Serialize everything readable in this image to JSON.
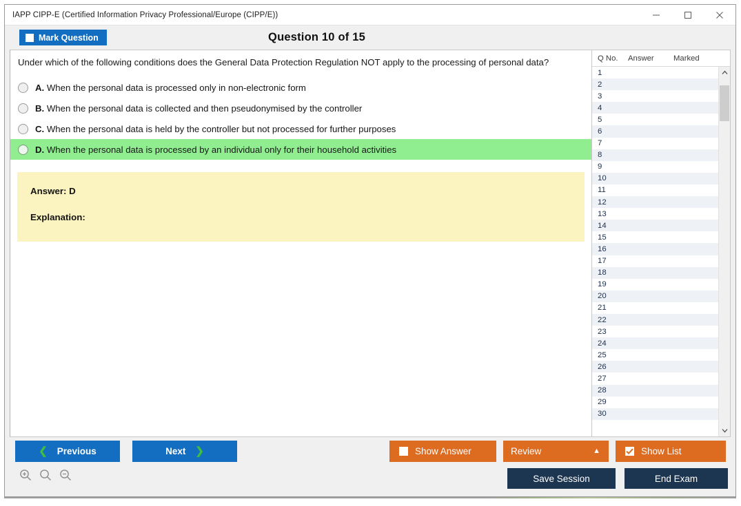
{
  "window": {
    "title": "IAPP CIPP-E (Certified Information Privacy Professional/Europe (CIPP/E))",
    "controls": {
      "minimize": "minimize-icon",
      "maximize": "maximize-icon",
      "close": "close-icon"
    }
  },
  "header": {
    "mark_button": "Mark Question",
    "question_counter": "Question 10 of 15"
  },
  "question": {
    "text": "Under which of the following conditions does the General Data Protection Regulation NOT apply to the processing of personal data?",
    "options": [
      {
        "letter": "A.",
        "text": "When the personal data is processed only in non-electronic form",
        "selected": false
      },
      {
        "letter": "B.",
        "text": "When the personal data is collected and then pseudonymised by the controller",
        "selected": false
      },
      {
        "letter": "C.",
        "text": "When the personal data is held by the controller but not processed for further purposes",
        "selected": false
      },
      {
        "letter": "D.",
        "text": "When the personal data is processed by an individual only for their household activities",
        "selected": true
      }
    ],
    "answer_label": "Answer: D",
    "explanation_label": "Explanation:"
  },
  "list_panel": {
    "columns": [
      "Q No.",
      "Answer",
      "Marked"
    ],
    "rows": [
      {
        "no": "1",
        "answer": "",
        "marked": ""
      },
      {
        "no": "2",
        "answer": "",
        "marked": ""
      },
      {
        "no": "3",
        "answer": "",
        "marked": ""
      },
      {
        "no": "4",
        "answer": "",
        "marked": ""
      },
      {
        "no": "5",
        "answer": "",
        "marked": ""
      },
      {
        "no": "6",
        "answer": "",
        "marked": ""
      },
      {
        "no": "7",
        "answer": "",
        "marked": ""
      },
      {
        "no": "8",
        "answer": "",
        "marked": ""
      },
      {
        "no": "9",
        "answer": "",
        "marked": ""
      },
      {
        "no": "10",
        "answer": "",
        "marked": ""
      },
      {
        "no": "11",
        "answer": "",
        "marked": ""
      },
      {
        "no": "12",
        "answer": "",
        "marked": ""
      },
      {
        "no": "13",
        "answer": "",
        "marked": ""
      },
      {
        "no": "14",
        "answer": "",
        "marked": ""
      },
      {
        "no": "15",
        "answer": "",
        "marked": ""
      },
      {
        "no": "16",
        "answer": "",
        "marked": ""
      },
      {
        "no": "17",
        "answer": "",
        "marked": ""
      },
      {
        "no": "18",
        "answer": "",
        "marked": ""
      },
      {
        "no": "19",
        "answer": "",
        "marked": ""
      },
      {
        "no": "20",
        "answer": "",
        "marked": ""
      },
      {
        "no": "21",
        "answer": "",
        "marked": ""
      },
      {
        "no": "22",
        "answer": "",
        "marked": ""
      },
      {
        "no": "23",
        "answer": "",
        "marked": ""
      },
      {
        "no": "24",
        "answer": "",
        "marked": ""
      },
      {
        "no": "25",
        "answer": "",
        "marked": ""
      },
      {
        "no": "26",
        "answer": "",
        "marked": ""
      },
      {
        "no": "27",
        "answer": "",
        "marked": ""
      },
      {
        "no": "28",
        "answer": "",
        "marked": ""
      },
      {
        "no": "29",
        "answer": "",
        "marked": ""
      },
      {
        "no": "30",
        "answer": "",
        "marked": ""
      }
    ]
  },
  "footer": {
    "previous": "Previous",
    "next": "Next",
    "show_answer": "Show Answer",
    "show_answer_checked": false,
    "review": "Review",
    "show_list": "Show List",
    "show_list_checked": true,
    "save_session": "Save Session",
    "end_exam": "End Exam",
    "zoom_in": "zoom-in-icon",
    "zoom_reset": "zoom-reset-icon",
    "zoom_out": "zoom-out-icon"
  },
  "colors": {
    "accent_blue": "#136ec2",
    "accent_orange": "#dd6b20",
    "dark_navy": "#1c3550",
    "selected_green": "#90ee90",
    "answer_yellow": "#fbf4c0",
    "chevron_green": "#3fbf3f"
  }
}
